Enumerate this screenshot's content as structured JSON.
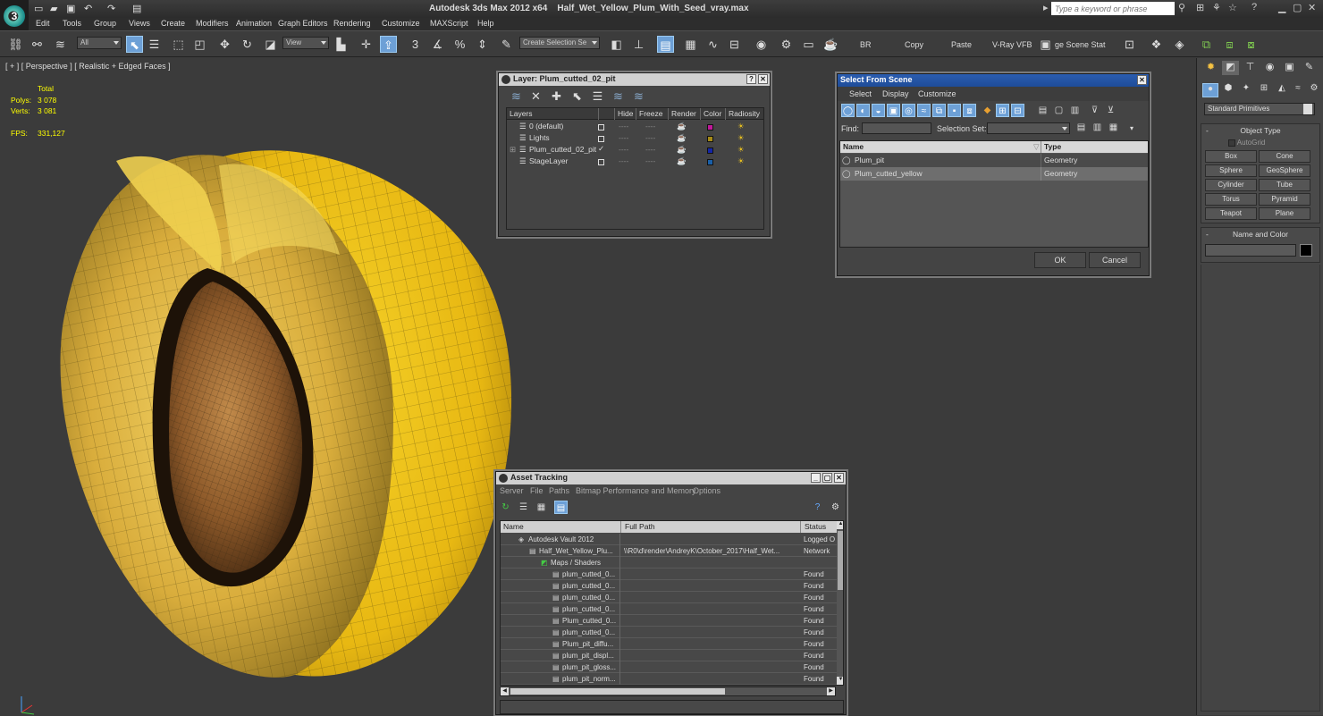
{
  "app": {
    "title": "Autodesk 3ds Max  2012 x64",
    "file": "Half_Wet_Yellow_Plum_With_Seed_vray.max",
    "search_placeholder": "Type a keyword or phrase"
  },
  "menu": [
    "Edit",
    "Tools",
    "Group",
    "Views",
    "Create",
    "Modifiers",
    "Animation",
    "Graph Editors",
    "Rendering",
    "Customize",
    "MAXScript",
    "Help"
  ],
  "toolbar": {
    "selection_filter": "All",
    "ref_coord": "View",
    "named_selection": "Create Selection Se",
    "br": "BR",
    "copy": "Copy",
    "paste": "Paste",
    "vray_vfb": "V-Ray VFB",
    "scene_states": "ge Scene Stat"
  },
  "viewport": {
    "label": "[ + ] [ Perspective ] [ Realistic + Edged Faces ]",
    "stats": {
      "total_label": "Total",
      "polys_label": "Polys:",
      "polys": "3 078",
      "verts_label": "Verts:",
      "verts": "3 081",
      "fps_label": "FPS:",
      "fps": "331,127"
    }
  },
  "layer_window": {
    "title": "Layer: Plum_cutted_02_pit",
    "columns": [
      "Layers",
      "Hide",
      "Freeze",
      "Render",
      "Color",
      "Radiosity"
    ],
    "rows": [
      {
        "name": "0 (default)",
        "color": "#c0199a",
        "current": false
      },
      {
        "name": "Lights",
        "color": "#a58a17",
        "current": false
      },
      {
        "name": "Plum_cutted_02_pit",
        "color": "#1426a8",
        "current": true
      },
      {
        "name": "StageLayer",
        "color": "#1a5fa8",
        "current": false
      }
    ]
  },
  "select_from_scene": {
    "title": "Select From Scene",
    "menu": [
      "Select",
      "Display",
      "Customize"
    ],
    "find_label": "Find:",
    "selset_label": "Selection Set:",
    "col_name": "Name",
    "col_type": "Type",
    "rows": [
      {
        "name": "Plum_pit",
        "type": "Geometry"
      },
      {
        "name": "Plum_cutted_yellow",
        "type": "Geometry"
      }
    ],
    "ok": "OK",
    "cancel": "Cancel"
  },
  "asset_tracking": {
    "title": "Asset Tracking",
    "menu": [
      "Server",
      "File",
      "Paths",
      "Bitmap Performance and Memory",
      "Options"
    ],
    "columns": [
      "Name",
      "Full Path",
      "Status"
    ],
    "rows": [
      {
        "name": "Autodesk Vault 2012",
        "path": "",
        "status": "Logged O",
        "indent": 1
      },
      {
        "name": "Half_Wet_Yellow_Plu...",
        "path": "\\\\R0\\d\\render\\AndreyK\\October_2017\\Half_Wet...",
        "status": "Network",
        "indent": 2
      },
      {
        "name": "Maps / Shaders",
        "path": "",
        "status": "",
        "indent": 3
      },
      {
        "name": "plum_cutted_0...",
        "path": "",
        "status": "Found",
        "indent": 4
      },
      {
        "name": "plum_cutted_0...",
        "path": "",
        "status": "Found",
        "indent": 4
      },
      {
        "name": "plum_cutted_0...",
        "path": "",
        "status": "Found",
        "indent": 4
      },
      {
        "name": "plum_cutted_0...",
        "path": "",
        "status": "Found",
        "indent": 4
      },
      {
        "name": "Plum_cutted_0...",
        "path": "",
        "status": "Found",
        "indent": 4
      },
      {
        "name": "plum_cutted_0...",
        "path": "",
        "status": "Found",
        "indent": 4
      },
      {
        "name": "Plum_pit_diffu...",
        "path": "",
        "status": "Found",
        "indent": 4
      },
      {
        "name": "plum_pit_displ...",
        "path": "",
        "status": "Found",
        "indent": 4
      },
      {
        "name": "plum_pit_gloss...",
        "path": "",
        "status": "Found",
        "indent": 4
      },
      {
        "name": "plum_pit_norm...",
        "path": "",
        "status": "Found",
        "indent": 4
      }
    ]
  },
  "command_panel": {
    "dropdown": "Standard Primitives",
    "object_type_title": "Object Type",
    "autogrid": "AutoGrid",
    "buttons": [
      "Box",
      "Cone",
      "Sphere",
      "GeoSphere",
      "Cylinder",
      "Tube",
      "Torus",
      "Pyramid",
      "Teapot",
      "Plane"
    ],
    "name_color_title": "Name and Color",
    "object_color": "#000000"
  }
}
